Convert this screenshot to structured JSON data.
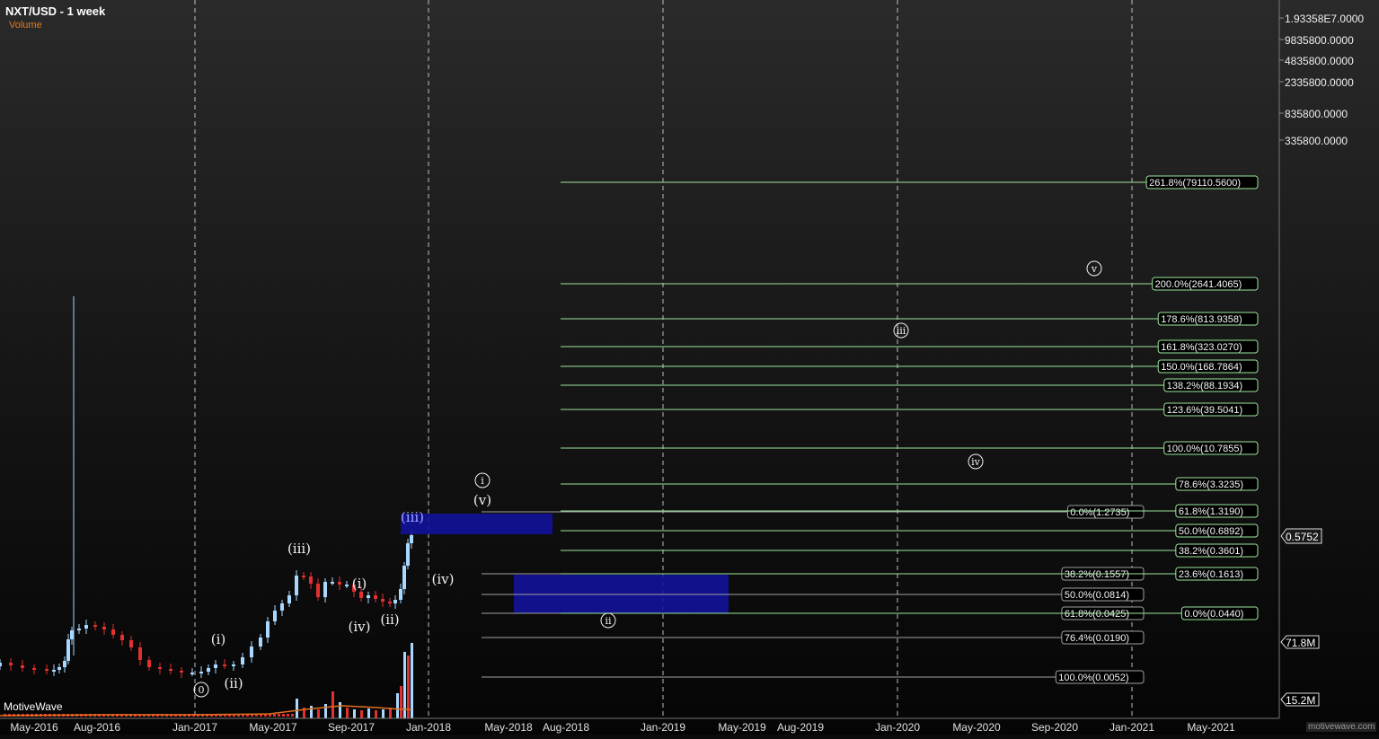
{
  "header": {
    "title": "NXT/USD - 1 week",
    "volume_label": "Volume"
  },
  "watermark_left": "MotiveWave",
  "watermark_right": "motivewave.com",
  "colors": {
    "fib_green": "#9be69b",
    "fib_gray": "#a0a0a0",
    "box_blue": "#12129a",
    "up": "#a8d8ff",
    "down": "#e03030",
    "vol_line": "#e07020"
  },
  "chart_data": {
    "type": "candlestick",
    "title": "NXT/USD - 1 week",
    "price_axis_labels": [
      "1.93358E7.0000",
      "9835800.0000",
      "4835800.0000",
      "2335800.0000",
      "835800.0000",
      "335800.0000"
    ],
    "current_price": "0.5752",
    "volume_axis_labels": [
      "71.8M",
      "15.2M"
    ],
    "x_axis_labels": [
      "May-2016",
      "Aug-2016",
      "Jan-2017",
      "May-2017",
      "Sep-2017",
      "Jan-2018",
      "May-2018",
      "Aug-2018",
      "Jan-2019",
      "May-2019",
      "Aug-2019",
      "Jan-2020",
      "May-2020",
      "Sep-2020",
      "Jan-2021",
      "May-2021"
    ],
    "dashed_vertical_dates": [
      "Jan-2017",
      "Jan-2018",
      "Jan-2019",
      "Jan-2020",
      "Jan-2021"
    ],
    "fib_extension_levels": [
      {
        "label": "261.8%(79110.5600)"
      },
      {
        "label": "200.0%(2641.4065)"
      },
      {
        "label": "178.6%(813.9358)"
      },
      {
        "label": "161.8%(323.0270)"
      },
      {
        "label": "150.0%(168.7864)"
      },
      {
        "label": "138.2%(88.1934)"
      },
      {
        "label": "123.6%(39.5041)"
      },
      {
        "label": "100.0%(10.7855)"
      },
      {
        "label": "78.6%(3.3235)"
      },
      {
        "label": "61.8%(1.3190)"
      },
      {
        "label": "50.0%(0.6892)"
      },
      {
        "label": "38.2%(0.3601)"
      },
      {
        "label": "23.6%(0.1613)"
      },
      {
        "label": "0.0%(0.0440)"
      }
    ],
    "fib_retracement_levels": [
      {
        "label": "0.0%(1.2735)"
      },
      {
        "label": "38.2%(0.1557)"
      },
      {
        "label": "50.0%(0.0814)"
      },
      {
        "label": "61.8%(0.0425)"
      },
      {
        "label": "76.4%(0.0190)"
      },
      {
        "label": "100.0%(0.0052)"
      }
    ],
    "wave_labels": [
      {
        "text": "0",
        "circled": true
      },
      {
        "text": "(i)",
        "circled": false
      },
      {
        "text": "(ii)",
        "circled": false
      },
      {
        "text": "(iii)",
        "circled": false
      },
      {
        "text": "(iv)",
        "circled": false
      },
      {
        "text": "(i)",
        "circled": false
      },
      {
        "text": "(ii)",
        "circled": false
      },
      {
        "text": "(iii)",
        "circled": false
      },
      {
        "text": "(iv)",
        "circled": false
      },
      {
        "text": "(v)",
        "circled": false
      },
      {
        "text": "i",
        "circled": true
      },
      {
        "text": "ii",
        "circled": true
      },
      {
        "text": "iii",
        "circled": true
      },
      {
        "text": "iv",
        "circled": true
      },
      {
        "text": "v",
        "circled": true
      }
    ]
  }
}
